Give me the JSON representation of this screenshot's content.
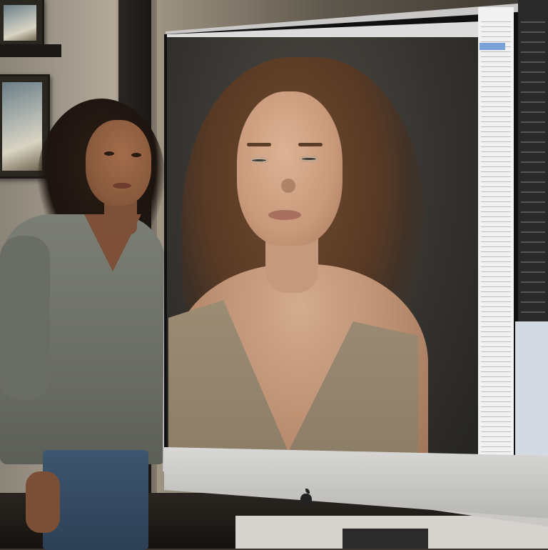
{
  "scene": {
    "monitor_brand": "apple-logo",
    "on_screen_portrait": "woman-with-long-brown-hair"
  },
  "colors": {
    "wall": "#b5ab9c",
    "monitor_body": "#c9c8c6",
    "screen_background": "#35332f",
    "panel_light": "#f1f1f1",
    "panel_dark": "#2a2a2a",
    "highlight": "#7aa2d8"
  }
}
